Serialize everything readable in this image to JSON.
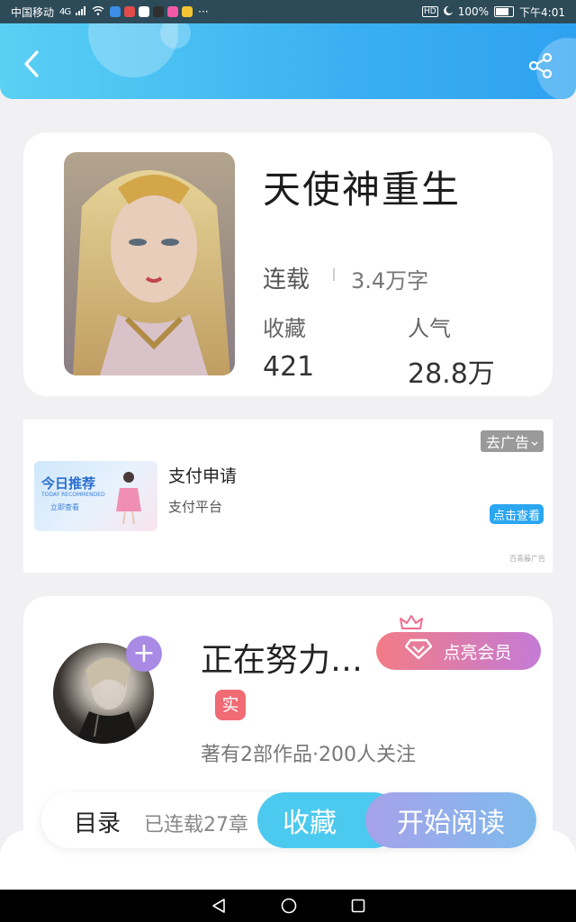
{
  "status_bar": {
    "carrier": "中国移动",
    "signal_text": "4G",
    "battery": "100%",
    "time": "下午4:01"
  },
  "header": {
    "back_icon": "chevron-left-icon",
    "share_icon": "share-icon"
  },
  "book": {
    "title": "天使神重生",
    "status": "连载",
    "words": "3.4万字",
    "collect_label": "收藏",
    "collect_value": "421",
    "popularity_label": "人气",
    "popularity_value": "28.8万"
  },
  "ad": {
    "close_label": "去广告",
    "image_title": "今日推荐",
    "image_subtitle": "TODAY RECOMMENDED",
    "image_cta": "立即查看",
    "title": "支付申请",
    "subtitle": "支付平台",
    "button": "点击查看",
    "source": "百青藤广告"
  },
  "author": {
    "name": "正在努力…",
    "vip_button": "点亮会员",
    "verified_badge": "实",
    "works_info": "著有2部作品·200人关注",
    "follow_icon": "+"
  },
  "bottom_bar": {
    "toc_label": "目录",
    "serial_count": "已连载27章",
    "collect_button": "收藏",
    "read_button": "开始阅读"
  },
  "colors": {
    "header_gradient_start": "#5ad0f4",
    "header_gradient_end": "#2ea2f0",
    "vip_gradient_start": "#f27c86",
    "vip_gradient_end": "#c47bd6",
    "collect_button": "#4cc9ee",
    "verified_badge": "#f06b74"
  }
}
